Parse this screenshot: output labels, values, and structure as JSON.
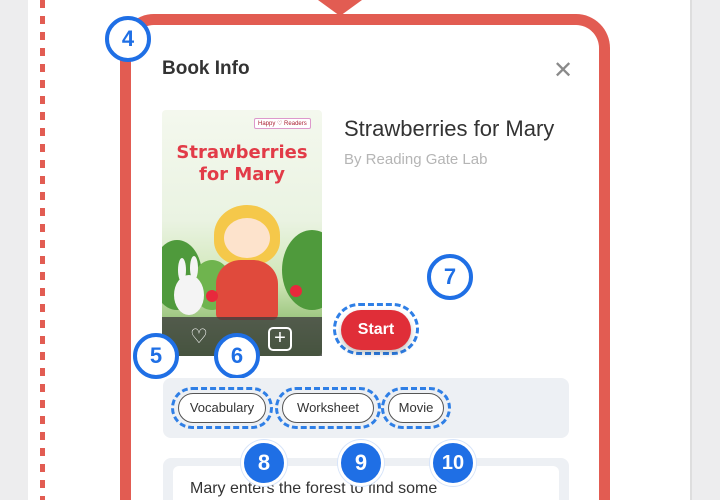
{
  "dialog": {
    "title": "Book Info",
    "close_icon": "close-icon"
  },
  "book": {
    "cover_badge": "Happy ♡ Readers",
    "cover_title_line1": "Strawberries",
    "cover_title_line2": "for Mary",
    "title": "Strawberries for Mary",
    "author": "By Reading Gate Lab",
    "description": "Mary enters the forest to find some"
  },
  "cover_actions": {
    "heart": "♡",
    "add": "+"
  },
  "start_label": "Start",
  "tags": [
    "Vocabulary",
    "Worksheet",
    "Movie"
  ],
  "callouts": {
    "n4": "4",
    "n5": "5",
    "n6": "6",
    "n7": "7",
    "n8": "8",
    "n9": "9",
    "n10": "10"
  },
  "colors": {
    "frame": "#e25c52",
    "callout_blue": "#1f6fe5",
    "start_red": "#e02e38"
  }
}
